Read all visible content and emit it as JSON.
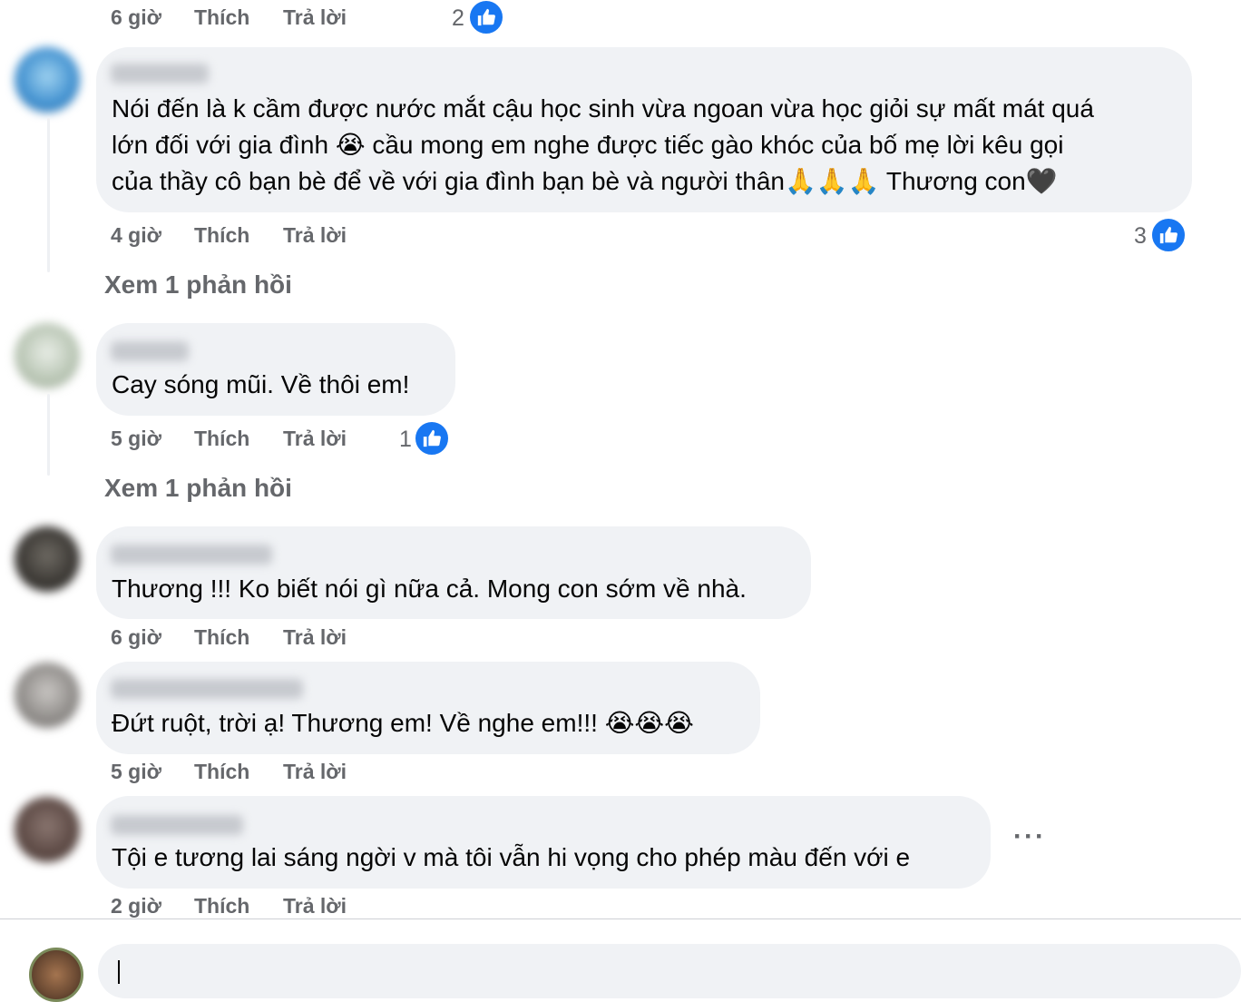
{
  "top_row": {
    "time": "6 giờ",
    "like": "Thích",
    "reply": "Trả lời",
    "reactions": "2"
  },
  "comments": [
    {
      "lines": [
        "Nói đến là k cầm được nước mắt cậu học sinh vừa ngoan vừa học giỏi sự mất mát quá",
        "lớn đối với gia đình 😭 cầu mong em nghe được tiếc gào khóc của bố mẹ lời kêu gọi",
        "của thầy cô bạn bè để về với gia đình bạn bè và người thân🙏🙏🙏 Thương con🖤"
      ],
      "time": "4 giờ",
      "like": "Thích",
      "reply": "Trả lời",
      "reactions": "3",
      "view_replies": "Xem 1 phản hồi"
    },
    {
      "lines": [
        "Cay sóng mũi. Về thôi em!"
      ],
      "time": "5 giờ",
      "like": "Thích",
      "reply": "Trả lời",
      "reactions": "1",
      "view_replies": "Xem 1 phản hồi"
    },
    {
      "lines": [
        "Thương !!! Ko biết nói gì nữa cả. Mong con sớm về nhà."
      ],
      "time": "6 giờ",
      "like": "Thích",
      "reply": "Trả lời"
    },
    {
      "lines": [
        "Đứt ruột, trời ạ! Thương em! Về nghe em!!! 😭😭😭"
      ],
      "time": "5 giờ",
      "like": "Thích",
      "reply": "Trả lời"
    },
    {
      "lines": [
        "Tội e tương lai sáng ngời v mà tôi vẫn hi vọng cho phép màu đến với e"
      ],
      "time": "2 giờ",
      "like": "Thích",
      "reply": "Trả lời",
      "more_menu": "···"
    }
  ],
  "colors": {
    "bubble": "#f0f2f5",
    "meta": "#65676b",
    "like_blue": "#1877f2",
    "text": "#050505"
  },
  "icons": {
    "reaction": "thumbs-up-icon",
    "more": "more-options-icon"
  }
}
